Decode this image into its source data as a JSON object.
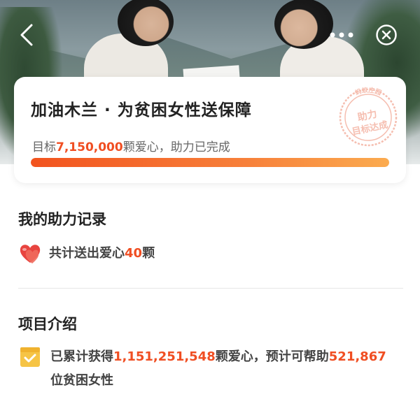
{
  "nav": {
    "back_icon": "chevron-left-icon",
    "more_icon": "more-dots-icon",
    "close_icon": "close-circle-icon"
  },
  "project": {
    "title": "加油木兰 · 为贫困女性送保障",
    "goal_prefix": "目标",
    "goal_value": "7,150,000",
    "goal_suffix": "颗爱心，助力已完成",
    "progress": 1.0,
    "stamp_top": "蚂蚁庄园",
    "stamp_line1": "助力",
    "stamp_line2": "目标达成"
  },
  "my_record": {
    "title": "我的助力记录",
    "icon": "heart-icon",
    "text_prefix": "共计送出爱心",
    "count": "40",
    "text_suffix": "颗"
  },
  "intro": {
    "title": "项目介绍",
    "icon": "checkbox-badge-icon",
    "text_prefix": "已累计获得",
    "hearts": "1,151,251,548",
    "text_mid": "颗爱心，预计可帮助",
    "people": "521,867",
    "text_suffix": "位贫困女性"
  },
  "colors": {
    "accent": "#f04e22",
    "progress_start": "#f2531e",
    "progress_end": "#fbab4f",
    "stamp": "#f0a08a"
  }
}
